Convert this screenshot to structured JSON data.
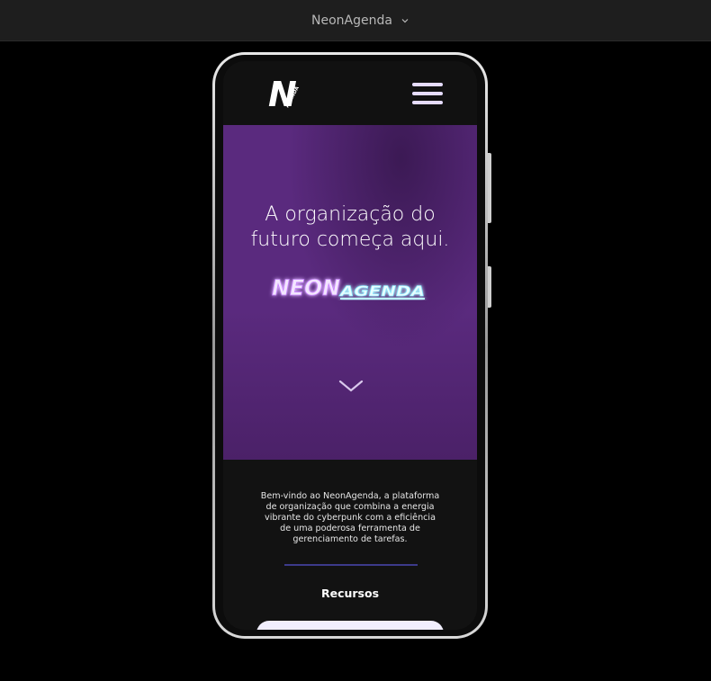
{
  "topbar": {
    "project_name": "NeonAgenda",
    "dropdown_icon": "chevron-down-icon"
  },
  "app": {
    "header": {
      "logo_letter": "N",
      "logo_subtext": "AGENDA",
      "menu_icon": "hamburger-icon"
    },
    "hero": {
      "title": "A organização do futuro começa aqui.",
      "brand_neon": "NEON",
      "brand_agenda": "AGENDA",
      "scroll_icon": "chevron-down-icon"
    },
    "intro_text": "Bem-vindo ao NeonAgenda, a plataforma de organização que combina a energia vibrante do cyberpunk com a eficiência de uma poderosa ferramenta de gerenciamento de tarefas.",
    "features_title": "Recursos"
  },
  "colors": {
    "topbar_bg": "#1e1e1e",
    "hero_purple": "#5a2a7e",
    "neon_pink": "#c77dff",
    "neon_cyan": "#9ff1ff",
    "divider": "#3c3a8a"
  }
}
